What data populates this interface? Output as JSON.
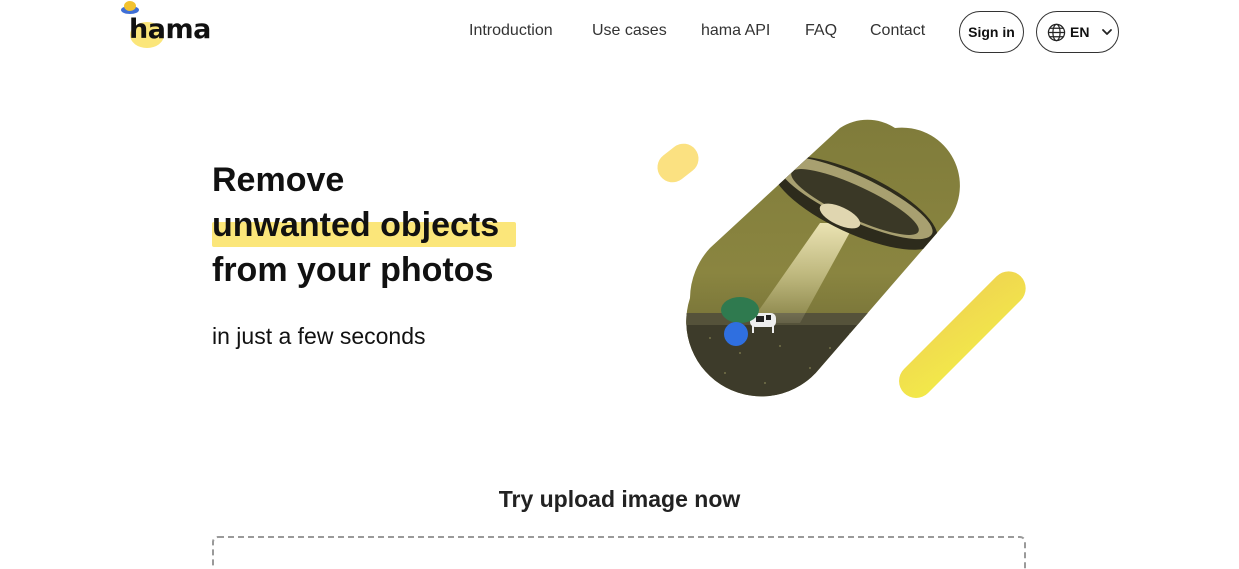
{
  "brand": {
    "name": "hama"
  },
  "nav": {
    "items": [
      {
        "label": "Introduction"
      },
      {
        "label": "Use cases"
      },
      {
        "label": "hama API"
      },
      {
        "label": "FAQ"
      },
      {
        "label": "Contact"
      }
    ],
    "sign_in": "Sign in",
    "language": {
      "code": "EN",
      "icon": "globe-icon"
    }
  },
  "hero": {
    "line1": "Remove",
    "line2": "unwanted objects",
    "line3": "from your photos",
    "subtitle": "in just a few seconds",
    "accent_color": "#fbe67a"
  },
  "upload": {
    "title": "Try upload image now"
  }
}
